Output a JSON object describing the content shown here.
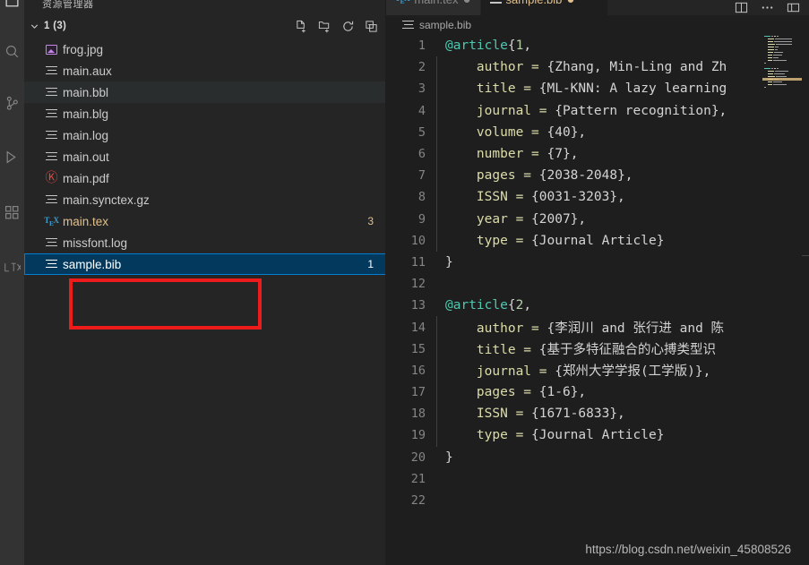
{
  "window": {
    "background": "#1e1e1e",
    "accent_selected": "#04395e",
    "accent_border": "#007fd4",
    "annotation_color": "#ee1b1b",
    "modified_color": "#e2c08d"
  },
  "activity_bar": {
    "items": [
      {
        "name": "explorer-icon",
        "label": "资源管理器"
      },
      {
        "name": "search-icon",
        "label": "搜索"
      },
      {
        "name": "source-control-icon",
        "label": "源代码管理"
      },
      {
        "name": "run-debug-icon",
        "label": "运行和调试"
      },
      {
        "name": "extensions-icon",
        "label": "扩展"
      },
      {
        "name": "latex-icon",
        "label": "LaTeX"
      }
    ]
  },
  "sidebar": {
    "title": "资源管理器",
    "section": {
      "label": "1 (3)",
      "expanded": true,
      "actions": [
        {
          "name": "new-file-icon",
          "label": "新建文件"
        },
        {
          "name": "new-folder-icon",
          "label": "新建文件夹"
        },
        {
          "name": "refresh-icon",
          "label": "刷新资源管理器"
        },
        {
          "name": "collapse-all-icon",
          "label": "在资源管理器中折叠文件夹"
        }
      ]
    },
    "files": [
      {
        "name": "frog.jpg",
        "icon": "image-icon",
        "badge": "",
        "state": "normal"
      },
      {
        "name": "main.aux",
        "icon": "text-file-icon",
        "badge": "",
        "state": "normal"
      },
      {
        "name": "main.bbl",
        "icon": "text-file-icon",
        "badge": "",
        "state": "hovered"
      },
      {
        "name": "main.blg",
        "icon": "text-file-icon",
        "badge": "",
        "state": "normal"
      },
      {
        "name": "main.log",
        "icon": "text-file-icon",
        "badge": "",
        "state": "normal"
      },
      {
        "name": "main.out",
        "icon": "text-file-icon",
        "badge": "",
        "state": "normal"
      },
      {
        "name": "main.pdf",
        "icon": "pdf-icon",
        "badge": "",
        "state": "normal"
      },
      {
        "name": "main.synctex.gz",
        "icon": "text-file-icon",
        "badge": "",
        "state": "normal"
      },
      {
        "name": "main.tex",
        "icon": "tex-icon",
        "badge": "3",
        "state": "modified"
      },
      {
        "name": "missfont.log",
        "icon": "text-file-icon",
        "badge": "",
        "state": "normal"
      },
      {
        "name": "sample.bib",
        "icon": "text-file-icon",
        "badge": "1",
        "state": "selected"
      }
    ]
  },
  "editor": {
    "tabs": [
      {
        "label": "main.tex",
        "icon": "tex-icon",
        "dirty": true,
        "active": false
      },
      {
        "label": "sample.bib",
        "icon": "text-file-icon",
        "dirty": true,
        "active": true
      }
    ],
    "tab_actions": [
      {
        "name": "split-editor-icon",
        "label": "拆分编辑器"
      },
      {
        "name": "more-actions-icon",
        "label": "更多操作"
      },
      {
        "name": "layout-icon",
        "label": "自定义布局"
      }
    ],
    "breadcrumb": {
      "icon": "text-file-icon",
      "label": "sample.bib"
    },
    "lines": [
      {
        "n": "1",
        "segments": [
          {
            "t": "@article",
            "c": "at"
          },
          {
            "t": "{",
            "c": "punct"
          },
          {
            "t": "1",
            "c": "num"
          },
          {
            "t": ",",
            "c": "punct"
          }
        ],
        "squiggle": false,
        "indent": false
      },
      {
        "n": "2",
        "segments": [
          {
            "t": "    author = ",
            "c": "field"
          },
          {
            "t": "{Zhang, Min-Ling and Zh",
            "c": "val"
          }
        ],
        "squiggle": false,
        "indent": true
      },
      {
        "n": "3",
        "segments": [
          {
            "t": "    title = ",
            "c": "field"
          },
          {
            "t": "{ML-KNN: A lazy learning",
            "c": "val"
          }
        ],
        "squiggle": false,
        "indent": true
      },
      {
        "n": "4",
        "segments": [
          {
            "t": "    journal = ",
            "c": "field"
          },
          {
            "t": "{Pattern recognition},",
            "c": "val"
          }
        ],
        "squiggle": false,
        "indent": true
      },
      {
        "n": "5",
        "segments": [
          {
            "t": "    volume = ",
            "c": "field"
          },
          {
            "t": "{40},",
            "c": "val"
          }
        ],
        "squiggle": false,
        "indent": true
      },
      {
        "n": "6",
        "segments": [
          {
            "t": "    number = ",
            "c": "field"
          },
          {
            "t": "{7},",
            "c": "val"
          }
        ],
        "squiggle": false,
        "indent": true
      },
      {
        "n": "7",
        "segments": [
          {
            "t": "    pages = ",
            "c": "field"
          },
          {
            "t": "{2038-2048},",
            "c": "val"
          }
        ],
        "squiggle": false,
        "indent": true
      },
      {
        "n": "8",
        "segments": [
          {
            "t": "    ISSN = ",
            "c": "field"
          },
          {
            "t": "{0031-3203},",
            "c": "val"
          }
        ],
        "squiggle": false,
        "indent": true
      },
      {
        "n": "9",
        "segments": [
          {
            "t": "    year = ",
            "c": "field"
          },
          {
            "t": "{2007},",
            "c": "val"
          }
        ],
        "squiggle": false,
        "indent": true
      },
      {
        "n": "10",
        "segments": [
          {
            "t": "    type = ",
            "c": "field"
          },
          {
            "t": "{Journal Article}",
            "c": "val"
          }
        ],
        "squiggle": false,
        "indent": true
      },
      {
        "n": "11",
        "segments": [
          {
            "t": "}",
            "c": "punct"
          }
        ],
        "squiggle": false,
        "indent": false
      },
      {
        "n": "12",
        "segments": [],
        "squiggle": false,
        "indent": false
      },
      {
        "n": "13",
        "segments": [
          {
            "t": "@article",
            "c": "at"
          },
          {
            "t": "{",
            "c": "punct"
          },
          {
            "t": "2",
            "c": "num"
          },
          {
            "t": ",",
            "c": "punct"
          }
        ],
        "squiggle": true,
        "indent": false
      },
      {
        "n": "14",
        "segments": [
          {
            "t": "    author = ",
            "c": "field"
          },
          {
            "t": "{李润川 and 张行进 and 陈",
            "c": "val"
          }
        ],
        "squiggle": false,
        "indent": true
      },
      {
        "n": "15",
        "segments": [
          {
            "t": "    title = ",
            "c": "field"
          },
          {
            "t": "{基于多特征融合的心搏类型识",
            "c": "val"
          }
        ],
        "squiggle": false,
        "indent": true
      },
      {
        "n": "16",
        "segments": [
          {
            "t": "    journal = ",
            "c": "field"
          },
          {
            "t": "{郑州大学学报(工学版)},",
            "c": "val"
          }
        ],
        "squiggle": false,
        "indent": true
      },
      {
        "n": "17",
        "segments": [
          {
            "t": "    pages = ",
            "c": "field"
          },
          {
            "t": "{1-6},",
            "c": "val"
          }
        ],
        "squiggle": false,
        "indent": true
      },
      {
        "n": "18",
        "segments": [
          {
            "t": "    ISSN = ",
            "c": "field"
          },
          {
            "t": "{1671-6833},",
            "c": "val"
          }
        ],
        "squiggle": false,
        "indent": true
      },
      {
        "n": "19",
        "segments": [
          {
            "t": "    type = ",
            "c": "field"
          },
          {
            "t": "{Journal Article}",
            "c": "val"
          }
        ],
        "squiggle": false,
        "indent": true
      },
      {
        "n": "20",
        "segments": [
          {
            "t": "}",
            "c": "punct"
          }
        ],
        "squiggle": false,
        "indent": false
      },
      {
        "n": "21",
        "segments": [],
        "squiggle": false,
        "indent": false
      },
      {
        "n": "22",
        "segments": [],
        "squiggle": false,
        "indent": false
      }
    ]
  },
  "watermark": "https://blog.csdn.net/weixin_45808526"
}
